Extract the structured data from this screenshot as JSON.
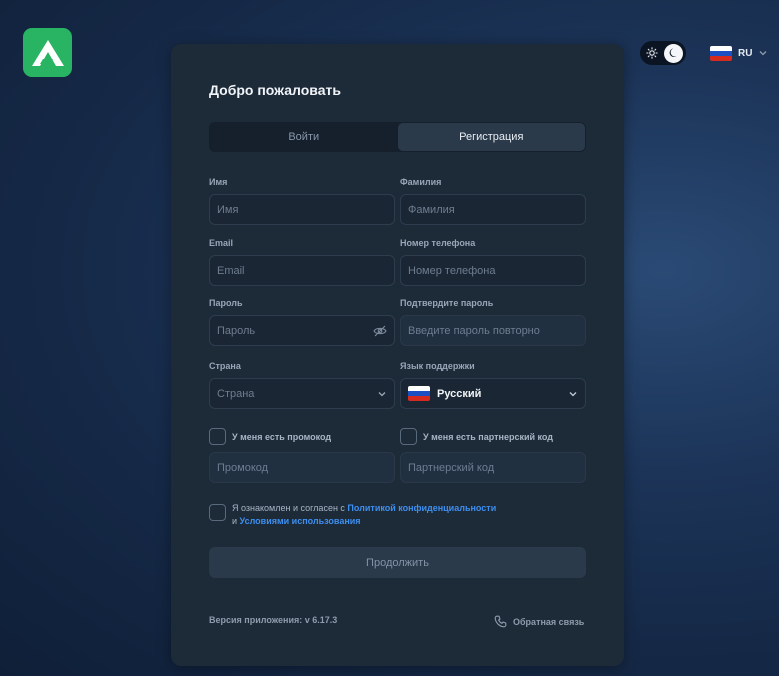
{
  "theme": {
    "accent": "#28b463",
    "link": "#3d8ff0",
    "current": "dark"
  },
  "header": {
    "language_code": "RU"
  },
  "form": {
    "title": "Добро пожаловать",
    "tabs": [
      {
        "label": "Войти",
        "active": false
      },
      {
        "label": "Регистрация",
        "active": true
      }
    ],
    "first_name": {
      "label": "Имя",
      "placeholder": "Имя"
    },
    "last_name": {
      "label": "Фамилия",
      "placeholder": "Фамилия"
    },
    "email": {
      "label": "Email",
      "placeholder": "Email"
    },
    "phone": {
      "label": "Номер телефона",
      "placeholder": "Номер телефона"
    },
    "password": {
      "label": "Пароль",
      "placeholder": "Пароль"
    },
    "confirm_password": {
      "label": "Подтвердите пароль",
      "placeholder": "Введите пароль повторно"
    },
    "country": {
      "label": "Страна",
      "placeholder": "Страна"
    },
    "support_language": {
      "label": "Язык поддержки",
      "value": "Русский"
    },
    "promo": {
      "checkbox_label": "У меня есть промокод",
      "placeholder": "Промокод",
      "checked": false
    },
    "partner": {
      "checkbox_label": "У меня есть партнерский код",
      "placeholder": "Партнерский код",
      "checked": false
    },
    "agreement": {
      "prefix": "Я ознакомлен и согласен с ",
      "privacy_link": "Политикой конфиденциальности",
      "conjunction": "и ",
      "terms_link": "Условиями использования",
      "checked": false
    },
    "submit_label": "Продолжить"
  },
  "footer": {
    "version": "Версия приложения: v 6.17.3",
    "feedback": "Обратная связь"
  }
}
